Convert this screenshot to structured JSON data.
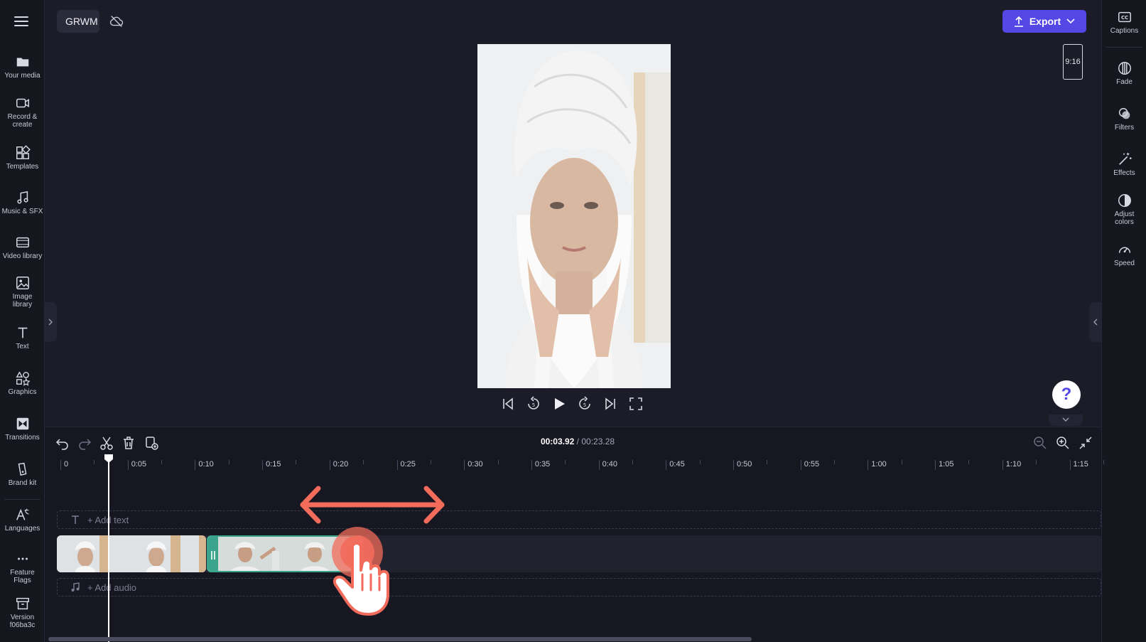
{
  "project": {
    "name": "GRWM"
  },
  "export": {
    "label": "Export"
  },
  "aspect_ratio": "9:16",
  "left_nav": [
    {
      "id": "your-media",
      "label": "Your media",
      "icon": "folder-icon"
    },
    {
      "id": "record",
      "label": "Record &",
      "label2": "create",
      "icon": "camera-icon"
    },
    {
      "id": "templates",
      "label": "Templates",
      "icon": "templates-icon"
    },
    {
      "id": "music",
      "label": "Music & SFX",
      "icon": "music-icon"
    },
    {
      "id": "video-library",
      "label": "Video library",
      "icon": "film-icon"
    },
    {
      "id": "image-library",
      "label": "Image",
      "label2": "library",
      "icon": "image-icon"
    },
    {
      "id": "text",
      "label": "Text",
      "icon": "text-icon"
    },
    {
      "id": "graphics",
      "label": "Graphics",
      "icon": "shapes-icon"
    },
    {
      "id": "transitions",
      "label": "Transitions",
      "icon": "transitions-icon"
    },
    {
      "id": "brand-kit",
      "label": "Brand kit",
      "icon": "brand-icon"
    },
    {
      "id": "languages",
      "label": "Languages",
      "icon": "languages-icon"
    },
    {
      "id": "feature-flags",
      "label": "Feature",
      "label2": "Flags",
      "icon": "more-icon"
    },
    {
      "id": "version",
      "label": "Version",
      "label2": "f06ba3c",
      "icon": "archive-icon"
    }
  ],
  "right_nav": [
    {
      "id": "captions",
      "label": "Captions",
      "icon": "captions-icon"
    },
    {
      "id": "fade",
      "label": "Fade",
      "icon": "fade-icon"
    },
    {
      "id": "filters",
      "label": "Filters",
      "icon": "filters-icon"
    },
    {
      "id": "effects",
      "label": "Effects",
      "icon": "magic-wand-icon"
    },
    {
      "id": "adjust-colors",
      "label": "Adjust",
      "label2": "colors",
      "icon": "contrast-icon"
    },
    {
      "id": "speed",
      "label": "Speed",
      "icon": "speedometer-icon"
    }
  ],
  "timeline": {
    "current_time": "00:03.92",
    "separator": "/",
    "total_time": "00:23.28",
    "ticks": [
      "0",
      "0:05",
      "0:10",
      "0:15",
      "0:20",
      "0:25",
      "0:30",
      "0:35",
      "0:40",
      "0:45",
      "0:50",
      "0:55",
      "1:00",
      "1:05",
      "1:10",
      "1:15"
    ],
    "add_text": "+ Add text",
    "add_audio": "+ Add audio"
  },
  "help": {
    "label": "?"
  },
  "colors": {
    "accent": "#5347e6",
    "clip_selected": "#3aa48c",
    "annotation": "#f26b5b"
  }
}
